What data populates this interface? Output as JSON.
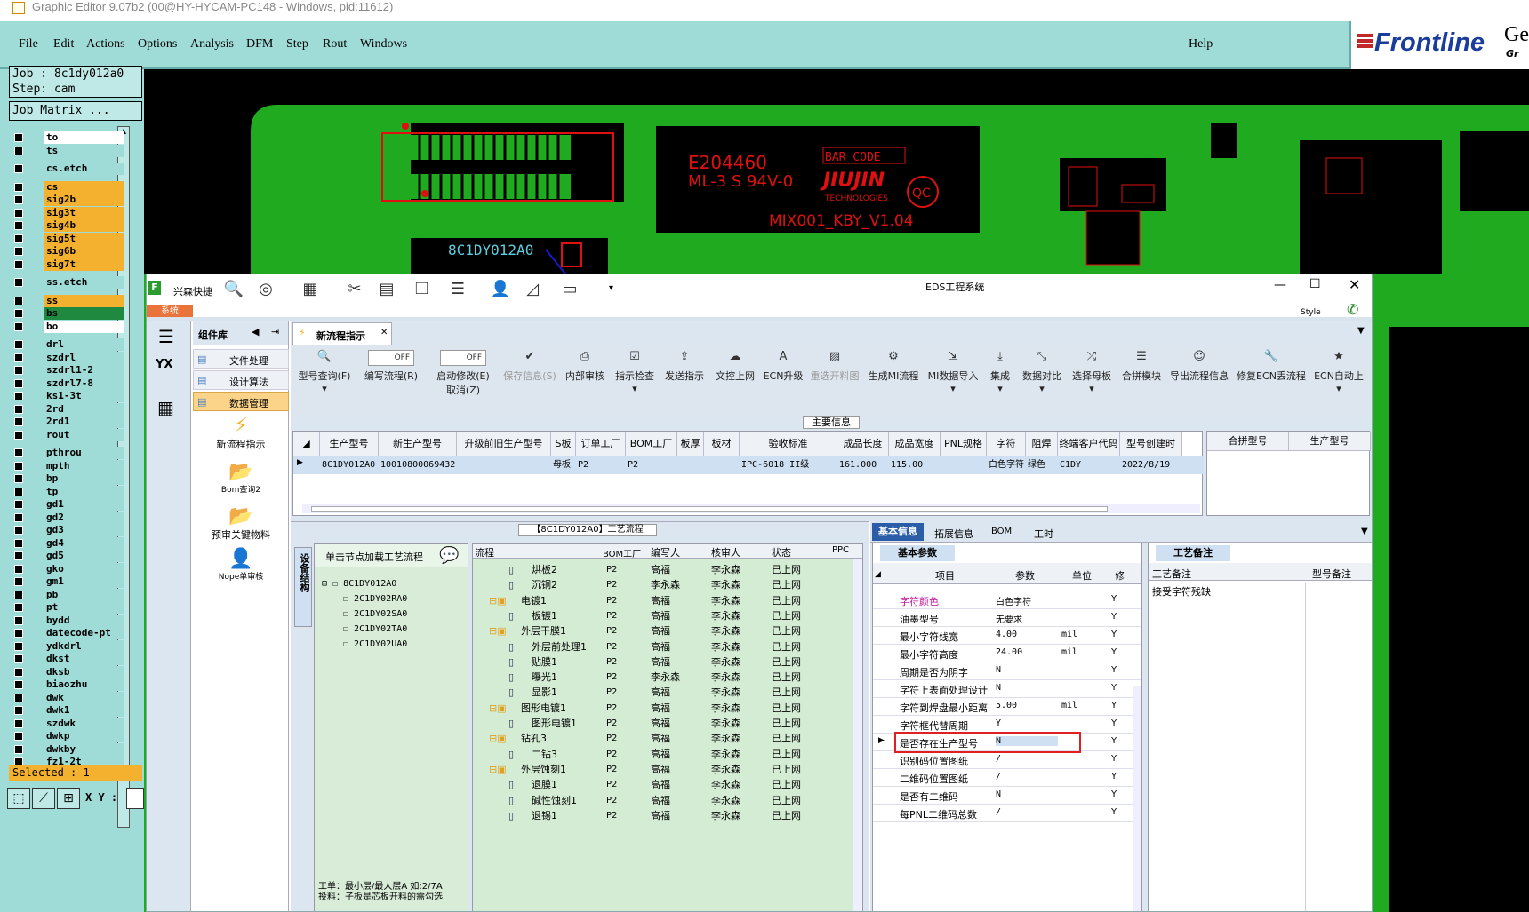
{
  "window_title": "Graphic Editor 9.07b2 (00@HY-HYCAM-PC148 - Windows, pid:11612)",
  "menu": [
    "File",
    "Edit",
    "Actions",
    "Options",
    "Analysis",
    "DFM",
    "Step",
    "Rout",
    "Windows"
  ],
  "help": "Help",
  "logo": {
    "brand": "Frontline",
    "side": "Ger",
    "side2": "Gr"
  },
  "job": {
    "job": "Job : 8c1dy012a0",
    "step": "Step: cam",
    "matrix": "Job Matrix ..."
  },
  "layers": [
    {
      "name": "to",
      "color": "#ffffff"
    },
    {
      "name": "ts",
      "color": "#9fdcd7"
    },
    {
      "name": "cs.etch",
      "color": "#9fdcd7"
    },
    {
      "name": "cs",
      "color": "#f4b12f"
    },
    {
      "name": "sig2b",
      "color": "#f4b12f"
    },
    {
      "name": "sig3t",
      "color": "#f4b12f"
    },
    {
      "name": "sig4b",
      "color": "#f4b12f"
    },
    {
      "name": "sig5t",
      "color": "#f4b12f"
    },
    {
      "name": "sig6b",
      "color": "#f4b12f"
    },
    {
      "name": "sig7t",
      "color": "#f4b12f"
    },
    {
      "name": "ss.etch",
      "color": "#9fdcd7"
    },
    {
      "name": "ss",
      "color": "#f4b12f"
    },
    {
      "name": "bs",
      "color": "#1f8a3f"
    },
    {
      "name": "bo",
      "color": "#ffffff"
    },
    {
      "name": "drl",
      "color": "#9fdcd7"
    },
    {
      "name": "szdrl",
      "color": "#9fdcd7"
    },
    {
      "name": "szdrl1-2",
      "color": "#9fdcd7"
    },
    {
      "name": "szdrl7-8",
      "color": "#9fdcd7"
    },
    {
      "name": "ks1-3t",
      "color": "#9fdcd7"
    },
    {
      "name": "2rd",
      "color": "#9fdcd7"
    },
    {
      "name": "2rd1",
      "color": "#9fdcd7"
    },
    {
      "name": "rout",
      "color": "#9fdcd7"
    },
    {
      "name": "pthrou",
      "color": "#9fdcd7"
    },
    {
      "name": "mpth",
      "color": "#9fdcd7"
    },
    {
      "name": "bp",
      "color": "#9fdcd7"
    },
    {
      "name": "tp",
      "color": "#9fdcd7"
    },
    {
      "name": "gd1",
      "color": "#9fdcd7"
    },
    {
      "name": "gd2",
      "color": "#9fdcd7"
    },
    {
      "name": "gd3",
      "color": "#9fdcd7"
    },
    {
      "name": "gd4",
      "color": "#9fdcd7"
    },
    {
      "name": "gd5",
      "color": "#9fdcd7"
    },
    {
      "name": "gko",
      "color": "#9fdcd7"
    },
    {
      "name": "gm1",
      "color": "#9fdcd7"
    },
    {
      "name": "pb",
      "color": "#9fdcd7"
    },
    {
      "name": "pt",
      "color": "#9fdcd7"
    },
    {
      "name": "bydd",
      "color": "#9fdcd7"
    },
    {
      "name": "datecode-pt",
      "color": "#9fdcd7"
    },
    {
      "name": "ydkdrl",
      "color": "#9fdcd7"
    },
    {
      "name": "dkst",
      "color": "#9fdcd7"
    },
    {
      "name": "dksb",
      "color": "#9fdcd7"
    },
    {
      "name": "biaozhu",
      "color": "#9fdcd7"
    },
    {
      "name": "dwk",
      "color": "#9fdcd7"
    },
    {
      "name": "dwk1",
      "color": "#9fdcd7"
    },
    {
      "name": "szdwk",
      "color": "#9fdcd7"
    },
    {
      "name": "dwkp",
      "color": "#9fdcd7"
    },
    {
      "name": "dwkby",
      "color": "#9fdcd7"
    },
    {
      "name": "fz1-2t",
      "color": "#9fdcd7"
    }
  ],
  "selected": "Selected : 1",
  "xy_label": "X Y :",
  "pcb": {
    "ul": "E204460",
    "ul2": "ML-3 S 94V-0",
    "barcode": "BAR CODE",
    "brand": "JIUJIN",
    "tech": "TECHNOLOGIES",
    "qc": "QC",
    "part": "MIX001_KBY_V1.04",
    "job_text": "8C1DY012A0"
  },
  "eds": {
    "app": "兴森快捷",
    "title": "EDS工程系统",
    "tab_system": "系统",
    "style": "Style",
    "component_lib": "组件库",
    "active_tab": "新流程指示",
    "side_menu": [
      "文件处理",
      "设计算法",
      "数据管理"
    ],
    "side_tools": [
      "新流程指示",
      "Bom查询2",
      "预审关键物料",
      "Nope单审核"
    ],
    "yx": "YX",
    "ribbon": [
      "型号查询(F)",
      "编写流程(R)",
      "启动修改(E)",
      "保存信息(S)",
      "内部审核",
      "指示检查",
      "发送指示",
      "文控上网",
      "ECN升级",
      "重选开料图",
      "生成MI流程",
      "MI数据导入",
      "集成",
      "数据对比",
      "选择母板",
      "合拼模块",
      "导出流程信息",
      "修复ECN丢流程",
      "ECN自动上"
    ],
    "ribbon_extra": "取消(Z)",
    "toggle": "OFF",
    "main_info": "主要信息",
    "grid_headers": [
      "生产型号",
      "新生产型号",
      "升级前旧生产型号",
      "S板",
      "订单工厂",
      "BOM工厂",
      "板厚",
      "板材",
      "验收标准",
      "成品长度",
      "成品宽度",
      "PNL规格",
      "字符",
      "阻焊",
      "终端客户代码",
      "型号创建时"
    ],
    "grid_row": [
      "8C1DY012A0",
      "10010800069432",
      "",
      "母板",
      "P2",
      "P2",
      "",
      "",
      "IPC-6018 II级",
      "161.000",
      "115.00",
      "",
      "白色字符",
      "绿色",
      "C1DY",
      "2022/8/19"
    ],
    "merge_headers": [
      "合拼型号",
      "生产型号"
    ],
    "flow_title": "【8C1DY012A0】工艺流程",
    "tree_tab": "设备结构",
    "tree_hint": "单击节点加载工艺流程",
    "tree": [
      "8C1DY012A0",
      "2C1DY02RA0",
      "2C1DY02SA0",
      "2C1DY02TA0",
      "2C1DY02UA0"
    ],
    "tree_note1": "工单：最小层/最大层A 如:2/7A",
    "tree_note2": "投料：子板是芯板开料的需勾选",
    "flow_headers": [
      "流程",
      "BOM工厂",
      "编写人",
      "核审人",
      "状态",
      "PPC"
    ],
    "flow_rows": [
      {
        "name": "烘板2",
        "lvl": 2,
        "f": "P2",
        "w": "高福",
        "r": "李永森",
        "s": "已上网"
      },
      {
        "name": "沉铜2",
        "lvl": 2,
        "f": "P2",
        "w": "李永森",
        "r": "李永森",
        "s": "已上网"
      },
      {
        "name": "电镀1",
        "lvl": 1,
        "f": "P2",
        "w": "高福",
        "r": "李永森",
        "s": "已上网"
      },
      {
        "name": "板镀1",
        "lvl": 2,
        "f": "P2",
        "w": "高福",
        "r": "李永森",
        "s": "已上网"
      },
      {
        "name": "外层干膜1",
        "lvl": 1,
        "f": "P2",
        "w": "高福",
        "r": "李永森",
        "s": "已上网"
      },
      {
        "name": "外层前处理1",
        "lvl": 2,
        "f": "P2",
        "w": "高福",
        "r": "李永森",
        "s": "已上网"
      },
      {
        "name": "贴膜1",
        "lvl": 2,
        "f": "P2",
        "w": "高福",
        "r": "李永森",
        "s": "已上网"
      },
      {
        "name": "曝光1",
        "lvl": 2,
        "f": "P2",
        "w": "李永森",
        "r": "李永森",
        "s": "已上网"
      },
      {
        "name": "显影1",
        "lvl": 2,
        "f": "P2",
        "w": "高福",
        "r": "李永森",
        "s": "已上网"
      },
      {
        "name": "图形电镀1",
        "lvl": 1,
        "f": "P2",
        "w": "高福",
        "r": "李永森",
        "s": "已上网"
      },
      {
        "name": "图形电镀1",
        "lvl": 2,
        "f": "P2",
        "w": "高福",
        "r": "李永森",
        "s": "已上网"
      },
      {
        "name": "钻孔3",
        "lvl": 1,
        "f": "P2",
        "w": "高福",
        "r": "李永森",
        "s": "已上网"
      },
      {
        "name": "二钻3",
        "lvl": 2,
        "f": "P2",
        "w": "高福",
        "r": "李永森",
        "s": "已上网"
      },
      {
        "name": "外层蚀刻1",
        "lvl": 1,
        "f": "P2",
        "w": "高福",
        "r": "李永森",
        "s": "已上网"
      },
      {
        "name": "退膜1",
        "lvl": 2,
        "f": "P2",
        "w": "高福",
        "r": "李永森",
        "s": "已上网"
      },
      {
        "name": "碱性蚀刻1",
        "lvl": 2,
        "f": "P2",
        "w": "高福",
        "r": "李永森",
        "s": "已上网"
      },
      {
        "name": "退锡1",
        "lvl": 2,
        "f": "P2",
        "w": "高福",
        "r": "李永森",
        "s": "已上网"
      }
    ],
    "prop_tabs": [
      "基本信息",
      "拓展信息",
      "BOM",
      "工时"
    ],
    "basic_params": "基本参数",
    "prop_headers": [
      "项目",
      "参数",
      "单位",
      "修"
    ],
    "props": [
      {
        "k": "字符颜色",
        "v": "白色字符",
        "u": "",
        "m": "Y",
        "pink": true
      },
      {
        "k": "油墨型号",
        "v": "无要求",
        "u": "",
        "m": "Y"
      },
      {
        "k": "最小字符线宽",
        "v": "4.00",
        "u": "mil",
        "m": "Y"
      },
      {
        "k": "最小字符高度",
        "v": "24.00",
        "u": "mil",
        "m": "Y"
      },
      {
        "k": "周期是否为阴字",
        "v": "N",
        "u": "",
        "m": "Y"
      },
      {
        "k": "字符上表面处理设计",
        "v": "N",
        "u": "",
        "m": "Y"
      },
      {
        "k": "字符到焊盘最小距离",
        "v": "5.00",
        "u": "mil",
        "m": "Y"
      },
      {
        "k": "字符框代替周期",
        "v": "Y",
        "u": "",
        "m": "Y"
      },
      {
        "k": "是否存在生产型号",
        "v": "N",
        "u": "",
        "m": "Y",
        "sel": true
      },
      {
        "k": "识别码位置图纸",
        "v": "/",
        "u": "",
        "m": "Y"
      },
      {
        "k": "二维码位置图纸",
        "v": "/",
        "u": "",
        "m": "Y"
      },
      {
        "k": "是否有二维码",
        "v": "N",
        "u": "",
        "m": "Y"
      },
      {
        "k": "每PNL二维码总数",
        "v": "/",
        "u": "",
        "m": "Y"
      }
    ],
    "remarks_tab": "工艺备注",
    "remarks_headers": [
      "工艺备注",
      "型号备注"
    ],
    "remark_text": "接受字符残缺",
    "colors": {
      "accent": "#1a3c9a",
      "highlight": "#e02020",
      "grid_green": "#cfe8cf"
    }
  }
}
